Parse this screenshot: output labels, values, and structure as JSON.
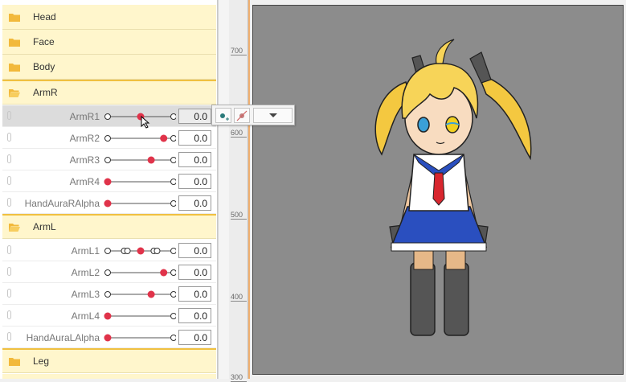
{
  "groups_top": [
    {
      "label": "Head"
    },
    {
      "label": "Face"
    },
    {
      "label": "Body"
    }
  ],
  "armR": {
    "label": "ArmR",
    "params": [
      {
        "label": "ArmR1",
        "value": "0.0",
        "knob": 0.5,
        "markers": [
          0,
          1
        ],
        "selected": true
      },
      {
        "label": "ArmR2",
        "value": "0.0",
        "knob": 0.85,
        "markers": [
          0,
          1
        ]
      },
      {
        "label": "ArmR3",
        "value": "0.0",
        "knob": 0.66,
        "markers": [
          0,
          1
        ]
      },
      {
        "label": "ArmR4",
        "value": "0.0",
        "knob": 0.0,
        "markers": [
          0,
          1
        ]
      },
      {
        "label": "HandAuraRAlpha",
        "value": "0.0",
        "knob": 0.0,
        "markers": [
          0,
          1
        ]
      }
    ]
  },
  "armL": {
    "label": "ArmL",
    "params": [
      {
        "label": "ArmL1",
        "value": "0.0",
        "knob": 0.5,
        "markers": [
          0,
          0.25,
          0.3,
          0.7,
          0.75,
          1
        ]
      },
      {
        "label": "ArmL2",
        "value": "0.0",
        "knob": 0.85,
        "markers": [
          0,
          1
        ]
      },
      {
        "label": "ArmL3",
        "value": "0.0",
        "knob": 0.66,
        "markers": [
          0,
          1
        ]
      },
      {
        "label": "ArmL4",
        "value": "0.0",
        "knob": 0.0,
        "markers": [
          0,
          1
        ]
      },
      {
        "label": "HandAuraLAlpha",
        "value": "0.0",
        "knob": 0.0,
        "markers": [
          0,
          1
        ]
      }
    ]
  },
  "groups_bottom": [
    {
      "label": "Leg"
    }
  ],
  "ruler": {
    "labels": [
      "700",
      "600",
      "500",
      "400",
      "300"
    ]
  },
  "colors": {
    "knob": "#e0334a",
    "group_bg": "#fff6cc",
    "folder": "#f2b93b",
    "canvas": "#8c8c8c"
  },
  "popup": {
    "buttons": [
      "add-key-icon",
      "remove-key-icon",
      "dropdown-icon"
    ]
  }
}
